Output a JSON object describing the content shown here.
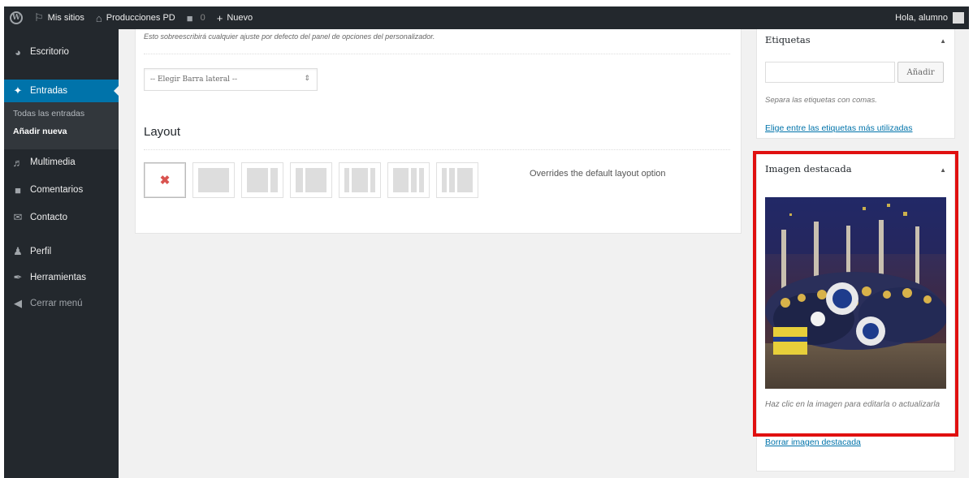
{
  "adminbar": {
    "my_sites": "Mis sitios",
    "site_name": "Producciones PD",
    "comments_count": "0",
    "new_label": "Nuevo",
    "greeting": "Hola, alumno"
  },
  "sidebar": {
    "items": [
      {
        "label": "Escritorio",
        "icon": "dashboard-icon"
      },
      {
        "label": "Entradas",
        "icon": "pin-icon"
      },
      {
        "label": "Multimedia",
        "icon": "media-icon"
      },
      {
        "label": "Comentarios",
        "icon": "comment-icon"
      },
      {
        "label": "Contacto",
        "icon": "mail-icon"
      },
      {
        "label": "Perfil",
        "icon": "user-icon"
      },
      {
        "label": "Herramientas",
        "icon": "wrench-icon"
      },
      {
        "label": "Cerrar menú",
        "icon": "collapse-icon"
      }
    ],
    "submenu": {
      "all_posts": "Todas las entradas",
      "add_new": "Añadir nueva"
    }
  },
  "main": {
    "override_note": "Esto sobreescribirá cualquier ajuste por defecto del panel de opciones del personalizador.",
    "sidebar_select": "-- Elegir Barra lateral --",
    "layout_title": "Layout",
    "layout_description": "Overrides the default layout option"
  },
  "tags": {
    "title": "Etiquetas",
    "add_button": "Añadir",
    "hint": "Separa las etiquetas con comas.",
    "choose_link": "Elige entre las etiquetas más utilizadas"
  },
  "featured": {
    "title": "Imagen destacada",
    "caption": "Haz clic en la imagen para editarla o actualizarla",
    "remove_link": "Borrar imagen destacada"
  },
  "colors": {
    "adminbar": "#23282d",
    "active_menu": "#0073aa",
    "highlight": "#e01010",
    "link": "#0073aa"
  }
}
